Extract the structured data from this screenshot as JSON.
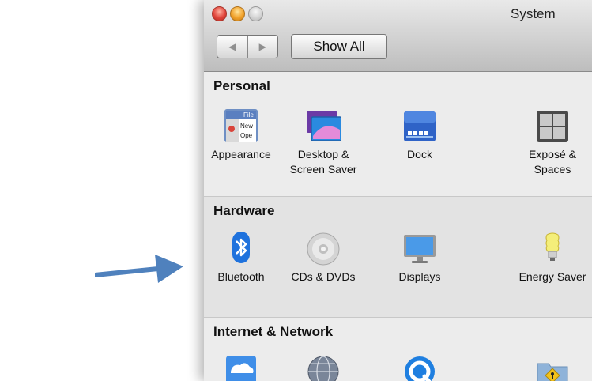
{
  "window": {
    "title": "System",
    "nav_back": "◀",
    "nav_forward": "▶",
    "show_all_label": "Show All"
  },
  "sections": {
    "personal": {
      "title": "Personal",
      "items": [
        {
          "label": "Appearance",
          "icon": "appearance-icon",
          "icon_text_1": "File",
          "icon_text_2": "New",
          "icon_text_3": "Ope"
        },
        {
          "label": "Desktop & Screen Saver",
          "icon": "desktop-icon"
        },
        {
          "label": "Dock",
          "icon": "dock-icon"
        },
        {
          "label": "Exposé & Spaces",
          "icon": "expose-icon"
        }
      ]
    },
    "hardware": {
      "title": "Hardware",
      "items": [
        {
          "label": "Bluetooth",
          "icon": "bluetooth-icon"
        },
        {
          "label": "CDs & DVDs",
          "icon": "cd-icon"
        },
        {
          "label": "Displays",
          "icon": "display-icon"
        },
        {
          "label": "Energy Saver",
          "icon": "lightbulb-icon"
        }
      ]
    },
    "internet": {
      "title": "Internet & Network",
      "items": [
        {
          "label": "",
          "icon": "cloud-icon"
        },
        {
          "label": "",
          "icon": "globe-icon"
        },
        {
          "label": "",
          "icon": "quicktime-icon"
        },
        {
          "label": "",
          "icon": "sharing-folder-icon"
        }
      ]
    }
  },
  "colors": {
    "arrow": "#4f81bd",
    "accent_blue": "#2d7fd6",
    "window_bg": "#ececec"
  }
}
